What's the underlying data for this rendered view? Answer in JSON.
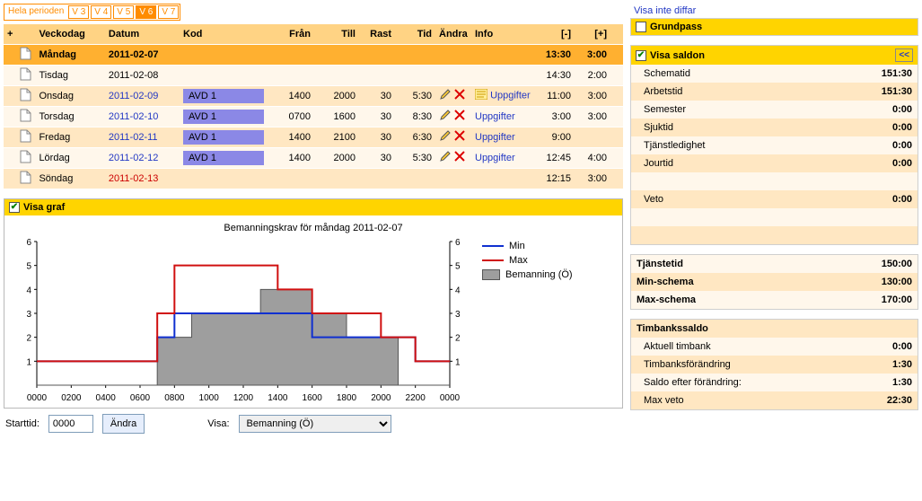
{
  "tabs": {
    "hela": "Hela perioden",
    "items": [
      "V 3",
      "V 4",
      "V 5",
      "V 6",
      "V 7"
    ],
    "active_index": 3
  },
  "sched": {
    "headers": {
      "plus": "+",
      "day": "Veckodag",
      "date": "Datum",
      "kod": "Kod",
      "from": "Från",
      "to": "Till",
      "rast": "Rast",
      "tid": "Tid",
      "andra": "Ändra",
      "info": "Info",
      "minus": "[-]",
      "plusc": "[+]"
    },
    "rows": [
      {
        "day": "Måndag",
        "date": "2011-02-07",
        "kod": "",
        "from": "",
        "to": "",
        "rast": "",
        "tid": "",
        "edit": false,
        "del": false,
        "info": "",
        "m": "13:30",
        "p": "3:00",
        "sel": true,
        "date_style": "plain"
      },
      {
        "day": "Tisdag",
        "date": "2011-02-08",
        "kod": "",
        "from": "",
        "to": "",
        "rast": "",
        "tid": "",
        "edit": false,
        "del": false,
        "info": "",
        "m": "14:30",
        "p": "2:00",
        "sel": false,
        "date_style": "plain"
      },
      {
        "day": "Onsdag",
        "date": "2011-02-09",
        "kod": "AVD 1",
        "from": "1400",
        "to": "2000",
        "rast": "30",
        "tid": "5:30",
        "edit": true,
        "del": true,
        "info": "Uppgifter",
        "noteicon": true,
        "m": "11:00",
        "p": "3:00",
        "sel": false,
        "date_style": "link"
      },
      {
        "day": "Torsdag",
        "date": "2011-02-10",
        "kod": "AVD 1",
        "from": "0700",
        "to": "1600",
        "rast": "30",
        "tid": "8:30",
        "edit": true,
        "del": true,
        "info": "Uppgifter",
        "m": "3:00",
        "p": "3:00",
        "sel": false,
        "date_style": "link"
      },
      {
        "day": "Fredag",
        "date": "2011-02-11",
        "kod": "AVD 1",
        "from": "1400",
        "to": "2100",
        "rast": "30",
        "tid": "6:30",
        "edit": true,
        "del": true,
        "info": "Uppgifter",
        "m": "9:00",
        "p": "",
        "sel": false,
        "date_style": "link"
      },
      {
        "day": "Lördag",
        "date": "2011-02-12",
        "kod": "AVD 1",
        "from": "1400",
        "to": "2000",
        "rast": "30",
        "tid": "5:30",
        "edit": true,
        "del": true,
        "info": "Uppgifter",
        "m": "12:45",
        "p": "4:00",
        "sel": false,
        "date_style": "link"
      },
      {
        "day": "Söndag",
        "date": "2011-02-13",
        "kod": "",
        "from": "",
        "to": "",
        "rast": "",
        "tid": "",
        "edit": false,
        "del": false,
        "info": "",
        "m": "12:15",
        "p": "3:00",
        "sel": false,
        "date_style": "red"
      }
    ]
  },
  "graph": {
    "panel_label": "Visa graf",
    "title": "Bemanningskrav för måndag 2011-02-07",
    "legend": {
      "min": "Min",
      "max": "Max",
      "bem": "Bemanning (Ö)"
    },
    "controls": {
      "start": "Starttid:",
      "start_val": "0000",
      "andra": "Ändra",
      "visa": "Visa:",
      "select": "Bemanning (Ö)"
    }
  },
  "chart_data": {
    "type": "area-step-multi",
    "xlabel": "",
    "ylabel": "",
    "x_ticks": [
      "0000",
      "0200",
      "0400",
      "0600",
      "0800",
      "1000",
      "1200",
      "1400",
      "1600",
      "1800",
      "2000",
      "2200",
      "0000"
    ],
    "ylim": [
      0,
      6
    ],
    "y_ticks": [
      1,
      2,
      3,
      4,
      5,
      6
    ],
    "series": [
      {
        "name": "Bemanning (Ö)",
        "type": "area",
        "color": "#9e9e9e",
        "steps": [
          [
            0,
            0
          ],
          [
            700,
            0
          ],
          [
            700,
            2
          ],
          [
            900,
            2
          ],
          [
            900,
            3
          ],
          [
            1300,
            3
          ],
          [
            1300,
            4
          ],
          [
            1600,
            4
          ],
          [
            1600,
            3
          ],
          [
            1800,
            3
          ],
          [
            1800,
            2
          ],
          [
            2100,
            2
          ],
          [
            2100,
            0
          ],
          [
            2400,
            0
          ]
        ]
      },
      {
        "name": "Min",
        "type": "step",
        "color": "#1030d0",
        "steps": [
          [
            0,
            1
          ],
          [
            700,
            1
          ],
          [
            700,
            2
          ],
          [
            800,
            2
          ],
          [
            800,
            3
          ],
          [
            1600,
            3
          ],
          [
            1600,
            2
          ],
          [
            2200,
            2
          ],
          [
            2200,
            1
          ],
          [
            2400,
            1
          ]
        ]
      },
      {
        "name": "Max",
        "type": "step",
        "color": "#d01010",
        "steps": [
          [
            0,
            1
          ],
          [
            700,
            1
          ],
          [
            700,
            3
          ],
          [
            800,
            3
          ],
          [
            800,
            5
          ],
          [
            1400,
            5
          ],
          [
            1400,
            4
          ],
          [
            1600,
            4
          ],
          [
            1600,
            3
          ],
          [
            2000,
            3
          ],
          [
            2000,
            2
          ],
          [
            2200,
            2
          ],
          [
            2200,
            1
          ],
          [
            2400,
            1
          ]
        ]
      }
    ]
  },
  "right": {
    "diff_link": "Visa inte diffar",
    "grundpass": "Grundpass",
    "saldon_label": "Visa saldon",
    "collapse": "<<",
    "saldon": [
      {
        "k": "Schematid",
        "v": "151:30"
      },
      {
        "k": "Arbetstid",
        "v": "151:30"
      },
      {
        "k": "Semester",
        "v": "0:00"
      },
      {
        "k": "Sjuktid",
        "v": "0:00"
      },
      {
        "k": "Tjänstledighet",
        "v": "0:00"
      },
      {
        "k": "Jourtid",
        "v": "0:00"
      },
      {
        "k": "",
        "v": ""
      },
      {
        "k": "Veto",
        "v": "0:00"
      },
      {
        "k": "",
        "v": ""
      },
      {
        "k": "",
        "v": ""
      }
    ],
    "block2": [
      {
        "k": "Tjänstetid",
        "v": "150:00"
      },
      {
        "k": "Min-schema",
        "v": "130:00"
      },
      {
        "k": "Max-schema",
        "v": "170:00"
      }
    ],
    "timbank_label": "Timbankssaldo",
    "block3": [
      {
        "k": "Aktuell timbank",
        "v": "0:00"
      },
      {
        "k": "Timbanksförändring",
        "v": "1:30"
      },
      {
        "k": "Saldo efter förändring:",
        "v": "1:30"
      },
      {
        "k": "Max veto",
        "v": "22:30"
      }
    ]
  }
}
